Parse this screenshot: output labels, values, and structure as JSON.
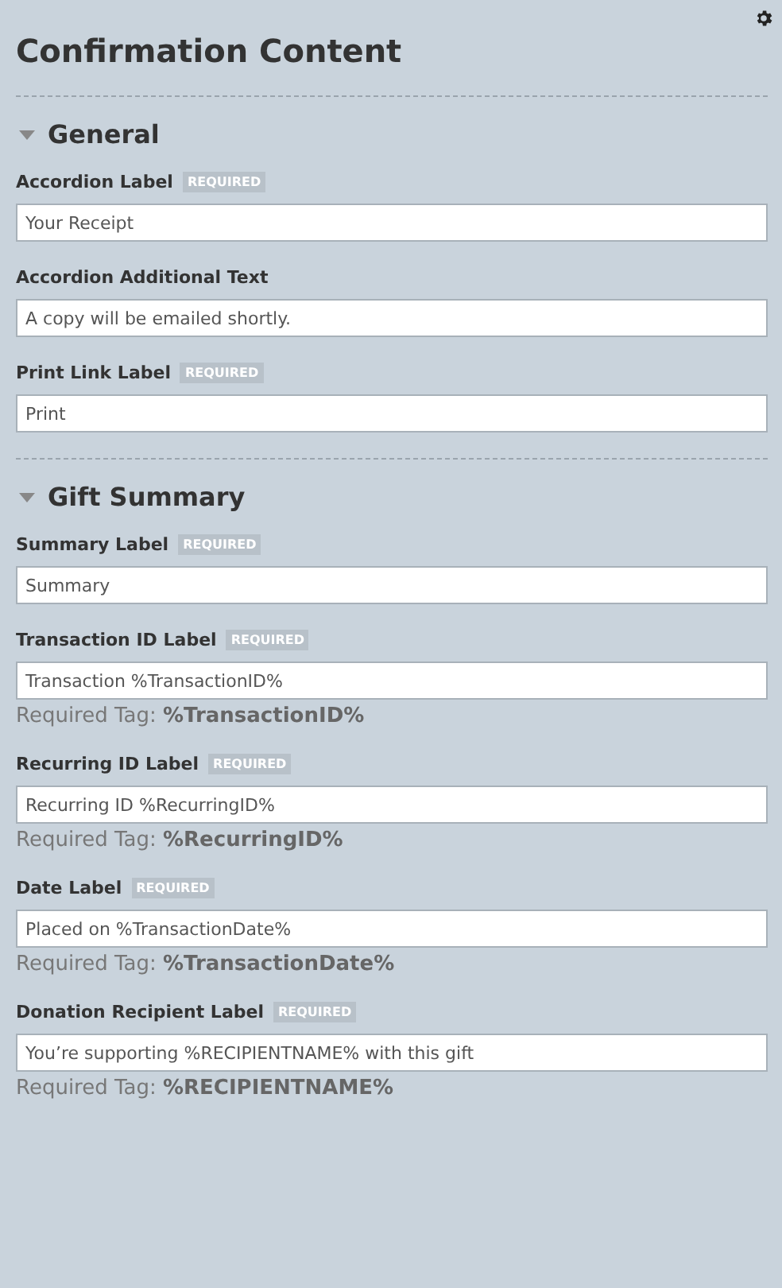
{
  "title": "Confirmation Content",
  "sections": [
    {
      "heading": "General",
      "expanded": true,
      "fields": [
        {
          "label": "Accordion Label",
          "badge": "REQUIRED",
          "value": "Your Receipt"
        },
        {
          "label": "Accordion Additional Text",
          "value": "A copy will be emailed shortly."
        },
        {
          "label": "Print Link Label",
          "badge": "REQUIRED",
          "value": "Print"
        }
      ]
    },
    {
      "heading": "Gift Summary",
      "expanded": true,
      "fields": [
        {
          "label": "Summary Label",
          "badge": "REQUIRED",
          "value": "Summary"
        },
        {
          "label": "Transaction ID Label",
          "badge": "REQUIRED",
          "value": "Transaction %TransactionID%",
          "hint": "Required Tag: **%TransactionID%**"
        },
        {
          "label": "Recurring ID Label",
          "badge": "REQUIRED",
          "value": "Recurring ID %RecurringID%",
          "hint": "Required Tag: **%RecurringID%**"
        },
        {
          "label": "Date Label",
          "badge": "REQUIRED",
          "value": "Placed on %TransactionDate%",
          "hint": "Required Tag: **%TransactionDate%**"
        },
        {
          "label": "Donation Recipient Label",
          "badge": "REQUIRED",
          "value": "You’re supporting %RECIPIENTNAME% with this gift",
          "hint": "Required Tag: **%RECIPIENTNAME%**"
        }
      ]
    }
  ]
}
